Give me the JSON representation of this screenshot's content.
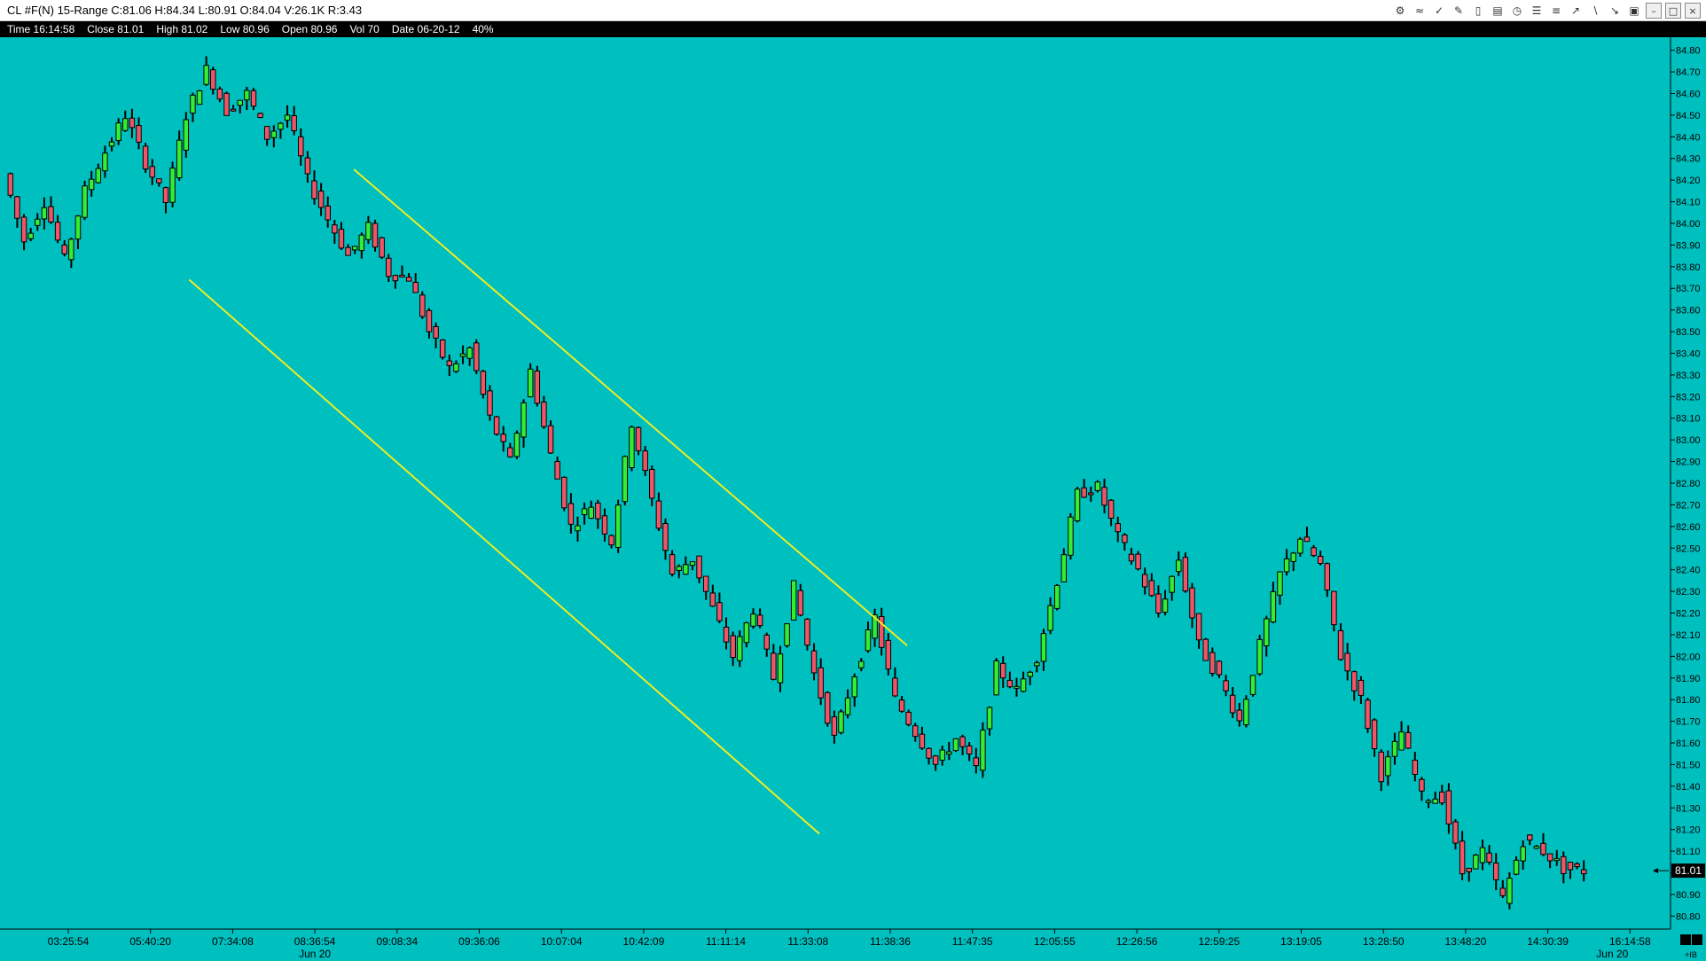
{
  "window": {
    "title": "CL #F(N)  15-Range  C:81.06  H:84.34  L:80.91  O:84.04  V:26.1K  R:3.43"
  },
  "toolbar": {
    "icons": [
      "snapshot-icon",
      "rainbow-icon",
      "indicator-icon",
      "pencil-icon",
      "bars-icon",
      "chart-icon",
      "clock-icon",
      "text-icon",
      "fib-icon",
      "trendline-icon",
      "brush-icon",
      "line-icon",
      "trash-icon",
      "minimize-icon",
      "restore-icon",
      "close-icon"
    ]
  },
  "infobar": {
    "time": "Time 16:14:58",
    "close": "Close 81.01",
    "high": "High 81.02",
    "low": "Low 80.96",
    "open": "Open 80.96",
    "vol": "Vol 70",
    "date": "Date 06-20-12",
    "zoom": "40%"
  },
  "colors": {
    "background": "#00bfbf",
    "up": "#33ee33",
    "down": "#ee5566",
    "wick": "#000000",
    "channel": "#eeee22"
  },
  "chart_data": {
    "type": "candlestick",
    "ylim": [
      80.74,
      84.86
    ],
    "y_ticks": [
      80.8,
      80.9,
      81.0,
      81.1,
      81.2,
      81.3,
      81.4,
      81.5,
      81.6,
      81.7,
      81.8,
      81.9,
      82.0,
      82.1,
      82.2,
      82.3,
      82.4,
      82.5,
      82.6,
      82.7,
      82.8,
      82.9,
      83.0,
      83.1,
      83.2,
      83.3,
      83.4,
      83.5,
      83.6,
      83.7,
      83.8,
      83.9,
      84.0,
      84.1,
      84.2,
      84.3,
      84.4,
      84.5,
      84.6,
      84.7,
      84.8
    ],
    "y_tick_labels": [
      "80.80",
      "80.90",
      "81.00",
      "81.10",
      "81.20",
      "81.30",
      "81.40",
      "81.50",
      "81.60",
      "81.70",
      "81.80",
      "81.90",
      "82.00",
      "82.10",
      "82.20",
      "82.30",
      "82.40",
      "82.50",
      "82.60",
      "82.70",
      "82.80",
      "82.90",
      "83.00",
      "83.10",
      "83.20",
      "83.30",
      "83.40",
      "83.50",
      "83.60",
      "83.70",
      "83.80",
      "83.90",
      "84.00",
      "84.10",
      "84.20",
      "84.30",
      "84.40",
      "84.50",
      "84.60",
      "84.70",
      "84.80"
    ],
    "x_tick_labels": [
      "03:25:54",
      "05:40:20",
      "07:34:08",
      "08:36:54",
      "09:08:34",
      "09:36:06",
      "10:07:04",
      "10:42:09",
      "11:11:14",
      "11:33:08",
      "11:38:36",
      "11:47:35",
      "12:05:55",
      "12:26:56",
      "12:59:25",
      "13:19:05",
      "13:28:50",
      "13:48:20",
      "14:30:39",
      "16:14:58"
    ],
    "x_date_labels": [
      {
        "after_tick": 3,
        "label": "Jun 20"
      },
      {
        "after_tick": 19,
        "label": "Jun 20"
      }
    ],
    "last_price": "81.01",
    "corner_label": "+IB",
    "path": [
      84.23,
      83.92,
      84.1,
      83.83,
      84.15,
      84.33,
      84.5,
      84.28,
      84.1,
      84.5,
      84.71,
      84.52,
      84.6,
      84.4,
      84.5,
      84.2,
      84.02,
      83.85,
      83.98,
      83.77,
      83.75,
      83.5,
      83.33,
      83.42,
      83.1,
      82.9,
      83.32,
      82.93,
      82.6,
      82.7,
      82.53,
      83.08,
      82.72,
      82.38,
      82.45,
      82.22,
      82.0,
      82.22,
      81.9,
      82.32,
      81.92,
      81.62,
      81.92,
      82.18,
      81.8,
      81.65,
      81.5,
      81.62,
      81.48,
      81.95,
      81.84,
      82.0,
      82.35,
      82.75,
      82.78,
      82.55,
      82.4,
      82.2,
      82.45,
      82.05,
      81.9,
      81.7,
      82.05,
      82.38,
      82.55,
      82.42,
      82.0,
      81.8,
      81.45,
      81.65,
      81.35,
      81.35,
      81.0,
      81.1,
      80.88,
      81.15,
      81.1,
      81.02,
      81.01
    ],
    "channel_lines": [
      {
        "x1": 0.1109,
        "y1": 83.74,
        "x2": 0.4803,
        "y2": 81.18
      },
      {
        "x1": 0.2074,
        "y1": 84.25,
        "x2": 0.5317,
        "y2": 82.05
      }
    ]
  }
}
